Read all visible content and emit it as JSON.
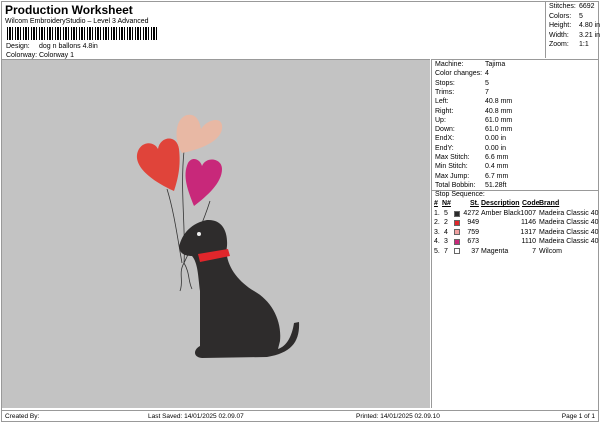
{
  "header": {
    "title": "Production Worksheet",
    "subtitle": "Wilcom EmbroideryStudio – Level 3 Advanced",
    "design_label": "Design:",
    "design_value": "dog n ballons 4.8in",
    "colorway_label": "Colorway:",
    "colorway_value": "Colorway 1"
  },
  "stats": [
    {
      "k": "Stitches:",
      "v": "6692"
    },
    {
      "k": "Colors:",
      "v": "5"
    },
    {
      "k": "Height:",
      "v": "4.80 in"
    },
    {
      "k": "Width:",
      "v": "3.21 in"
    },
    {
      "k": "Zoom:",
      "v": "1:1"
    }
  ],
  "details": [
    {
      "k": "Machine:",
      "v": "Tajima"
    },
    {
      "k": "Color changes:",
      "v": "4"
    },
    {
      "k": "Stops:",
      "v": "5"
    },
    {
      "k": "Trims:",
      "v": "7"
    },
    {
      "k": "Left:",
      "v": "40.8 mm"
    },
    {
      "k": "Right:",
      "v": "40.8 mm"
    },
    {
      "k": "Up:",
      "v": "61.0 mm"
    },
    {
      "k": "Down:",
      "v": "61.0 mm"
    },
    {
      "k": "EndX:",
      "v": "0.00 in"
    },
    {
      "k": "EndY:",
      "v": "0.00 in"
    },
    {
      "k": "Max Stitch:",
      "v": "6.6 mm"
    },
    {
      "k": "Min Stitch:",
      "v": "0.4 mm"
    },
    {
      "k": "Max Jump:",
      "v": "6.7 mm"
    },
    {
      "k": "Total Bobbin:",
      "v": "51.28ft"
    }
  ],
  "stop_sequence": {
    "label": "Stop Sequence:",
    "headers": [
      "#",
      "N#",
      "St.",
      "Description",
      "Code",
      "Brand"
    ],
    "rows": [
      {
        "n": "1.",
        "nn": "5",
        "color": "#2b2b2b",
        "st": "4272",
        "desc": "Amber Black",
        "code": "1007",
        "brand": "Madeira Classic 40"
      },
      {
        "n": "2.",
        "nn": "2",
        "color": "#e0262b",
        "st": "949",
        "desc": "",
        "code": "1146",
        "brand": "Madeira Classic 40"
      },
      {
        "n": "3.",
        "nn": "4",
        "color": "#f0a0a0",
        "st": "759",
        "desc": "",
        "code": "1317",
        "brand": "Madeira Classic 40"
      },
      {
        "n": "4.",
        "nn": "3",
        "color": "#c8287a",
        "st": "673",
        "desc": "",
        "code": "1110",
        "brand": "Madeira Classic 40"
      },
      {
        "n": "5.",
        "nn": "7",
        "color": "#ffffff",
        "st": "37",
        "desc": "Magenta",
        "code": "7",
        "brand": "Wilcom"
      }
    ]
  },
  "footer": {
    "created": "Created By:",
    "saved": "Last Saved: 14/01/2025 02.09.07",
    "printed": "Printed: 14/01/2025 02.09.10",
    "page": "Page 1 of 1"
  },
  "colors": {
    "canvas": "#c3c3c3",
    "dog": "#2e2c2c",
    "collar": "#e0262b",
    "heart_red": "#e0443a",
    "heart_peach": "#e8b8a4",
    "heart_pink": "#c8287a"
  }
}
